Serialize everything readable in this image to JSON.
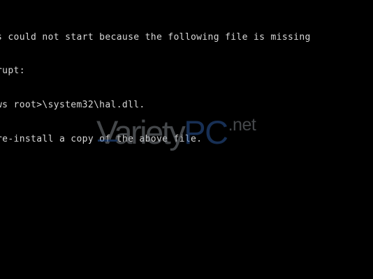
{
  "console": {
    "lines": [
      "s could not start because the following file is missing",
      "rupt:",
      "ws root>\\system32\\hal.dll.",
      "re-install a copy of the above file."
    ]
  },
  "watermark": {
    "brand": "Variety",
    "pc": "PC",
    "tld": ".net"
  },
  "colors": {
    "background": "#000000",
    "console_text": "#d8d8d8",
    "watermark_gray": "#8a8f96",
    "watermark_blue": "#2f5fa8"
  }
}
